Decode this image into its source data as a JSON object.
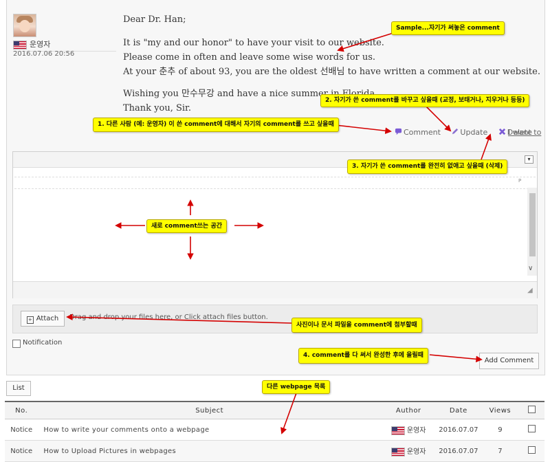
{
  "comment": {
    "author": "운영자",
    "date": "2016.07.06 20:56",
    "salutation": "Dear Dr. Han;",
    "lines": [
      "It is \"my and our honor\" to have your visit to our website.",
      "Please come in often and leave some wise words for us.",
      "At your 춘추 of about 93, you are the oldest 선배님 to have written a comment at our website.",
      "Wishing you 만수무강 and have a nice summer in Florida.",
      "Thank you, Sir."
    ],
    "actions": {
      "comment": "Comment",
      "update": "Update",
      "delete": "Delete",
      "want_to": "I want to"
    }
  },
  "editor": {
    "paragraph_marker": "P"
  },
  "attach": {
    "button": "Attach",
    "hint": "Drag and drop your files here, or Click attach files button."
  },
  "notification_label": "Notification",
  "add_comment_button": "Add Comment",
  "list_button": "List",
  "board": {
    "headers": [
      "No.",
      "Subject",
      "Author",
      "Date",
      "Views"
    ],
    "rows": [
      {
        "no": "Notice",
        "subject": "How to write your comments onto a webpage",
        "author": "운영자",
        "date": "2016.07.07",
        "views": "9"
      },
      {
        "no": "Notice",
        "subject": "How to Upload Pictures in webpages",
        "author": "운영자",
        "date": "2016.07.07",
        "views": "7"
      }
    ]
  },
  "annotations": {
    "sample": "Sample...자기가 써놓은 comment",
    "edit": "2. 자기가 쓴 comment를 바꾸고 싶을때 (교정, 보태거나, 지우거나 등등)",
    "reply": "1. 다른 사람 (예: 운영자) 이 쓴 comment에 대해서 자기의 comment를 쓰고 싶을때",
    "delete": "3. 자기가 쓴 comment를 완전히 없애고 싶을때 (삭제)",
    "new_space": "새로 comment쓰는 공간",
    "attach": "사진이나 문서 파일을 comment에 첨부할때",
    "submit": "4. comment를 다 써서 완성한 후에 올릴때",
    "other_pages": "다른 webpage 목록"
  },
  "colors": {
    "callout": "#ffff00",
    "arrow": "#d40000"
  }
}
